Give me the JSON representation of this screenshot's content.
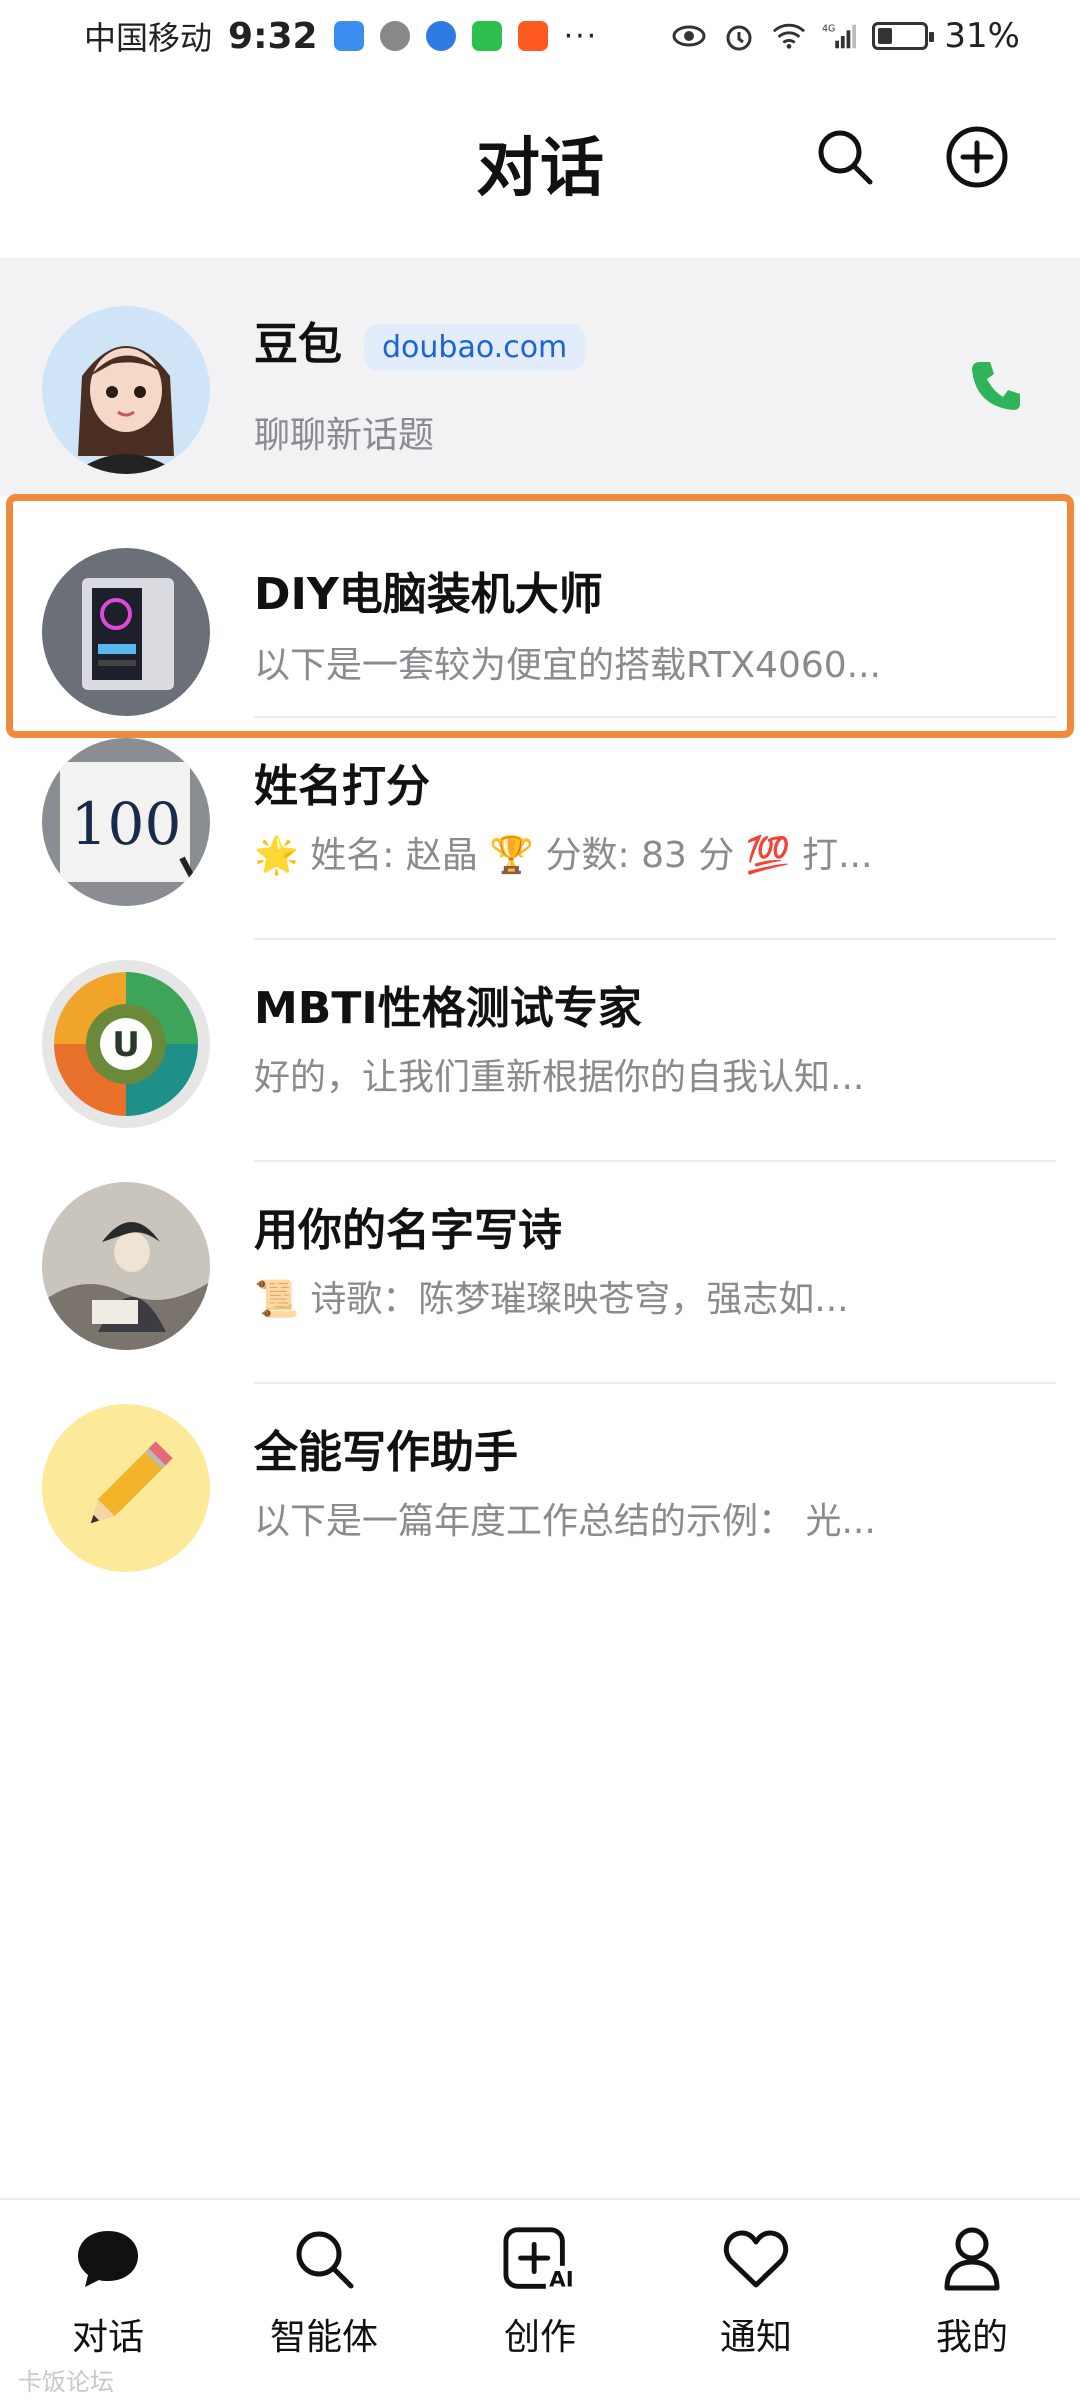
{
  "status_bar": {
    "carrier": "中国移动",
    "time": "9:32",
    "more": "···",
    "battery_percent": "31%",
    "battery_level": 0.31
  },
  "header": {
    "title": "对话",
    "search_icon": "search-icon",
    "add_icon": "plus-circle-icon"
  },
  "conversations": [
    {
      "name": "豆包",
      "tag": "doubao.com",
      "preview": "聊聊新话题",
      "pinned": true,
      "action_icon": "phone-icon"
    },
    {
      "name": "DIY电脑装机大师",
      "preview": "以下是一套较为便宜的搭载RTX4060...",
      "highlighted": true
    },
    {
      "name": "姓名打分",
      "preview": "🌟 姓名: 赵晶 🏆 分数: 83 分 💯 打..."
    },
    {
      "name": "MBTI性格测试专家",
      "preview": "好的，让我们重新根据你的自我认知..."
    },
    {
      "name": "用你的名字写诗",
      "preview": "📜 诗歌：陈梦璀璨映苍穹，强志如..."
    },
    {
      "name": "全能写作助手",
      "preview": "以下是一篇年度工作总结的示例：  光..."
    }
  ],
  "bottom_nav": [
    {
      "label": "对话",
      "icon": "chat-bubble-icon",
      "active": true
    },
    {
      "label": "智能体",
      "icon": "search-icon"
    },
    {
      "label": "创作",
      "icon": "create-ai-icon",
      "badge": "AI"
    },
    {
      "label": "通知",
      "icon": "heart-icon"
    },
    {
      "label": "我的",
      "icon": "person-icon"
    }
  ],
  "watermark": "卡饭论坛",
  "colors": {
    "highlight": "#f08a3c",
    "tag_bg": "#e3ecfb",
    "tag_text": "#1b63d6",
    "call_green": "#2fb45a"
  }
}
